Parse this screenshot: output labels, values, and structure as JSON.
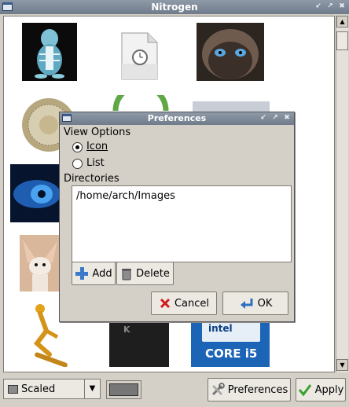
{
  "window": {
    "title": "Nitrogen"
  },
  "dialog": {
    "title": "Preferences",
    "view_options_label": "View Options",
    "view_options": [
      {
        "label": "Icon",
        "selected": true
      },
      {
        "label": "List",
        "selected": false
      }
    ],
    "directories_label": "Directories",
    "directories": [
      "/home/arch/Images"
    ],
    "add_label": "Add",
    "delete_label": "Delete",
    "cancel_label": "Cancel",
    "ok_label": "OK"
  },
  "bottom": {
    "mode_value": "Scaled",
    "bg_color": "#777777",
    "preferences_label": "Preferences",
    "apply_label": "Apply"
  },
  "thumbnails": [
    "tux-xray",
    "clock-file",
    "siamese-cat",
    "coin-fan",
    "green-sphere",
    "waves",
    "blue-eye",
    "fennec-fox",
    "golden-skater",
    "tshirt",
    "intel-core-i5"
  ],
  "thumbnail_text": {
    "intel_core": "CORE i5",
    "intel_brand": "intel"
  },
  "colors": {
    "titlebar": "#7a8696",
    "background": "#d4d0c8"
  }
}
